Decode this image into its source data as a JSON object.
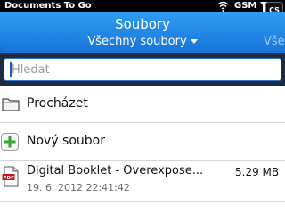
{
  "status_bar": {
    "app_name": "Documents To Go",
    "carrier": "GSM",
    "badge": "CS",
    "icons": [
      "wifi-icon",
      "signal-icon"
    ]
  },
  "title_bar": {
    "title": "Soubory",
    "subtitle": "Všechny soubory",
    "peek_right": "Vše",
    "colors": {
      "background": "#1a86e6",
      "text": "#ffffff"
    }
  },
  "search": {
    "placeholder": "Hledat",
    "value": ""
  },
  "list": {
    "browse_label": "Procházet",
    "new_file_label": "Nový soubor",
    "files": [
      {
        "name": "Digital Booklet - Overexpose...",
        "size": "5.29 MB",
        "date": "19. 6. 2012 22:41:42",
        "icon": "pdf-icon"
      }
    ]
  }
}
